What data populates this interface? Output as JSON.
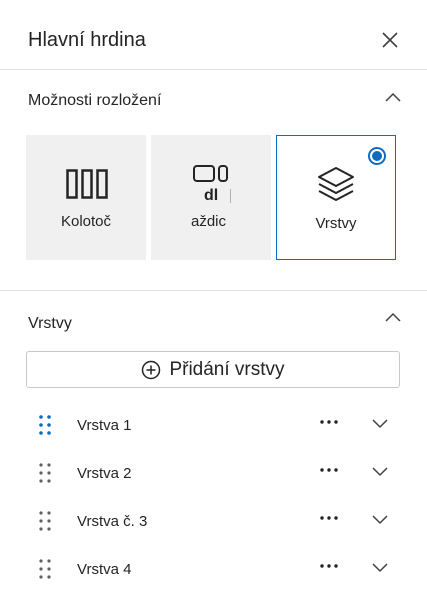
{
  "panel": {
    "title": "Hlavní hrdina"
  },
  "layout_section": {
    "title": "Možnosti rozložení",
    "options": [
      {
        "label": "Kolotoč",
        "icon": "carousel-icon",
        "selected": false
      },
      {
        "label": "aždic",
        "icon": "tiles-icon",
        "icon_text": "dl",
        "selected": false
      },
      {
        "label": "Vrstvy",
        "icon": "layers-icon",
        "selected": true
      }
    ]
  },
  "layers_section": {
    "title": "Vrstvy",
    "add_button_label": "Přidání vrstvy",
    "items": [
      {
        "name": "Vrstva 1",
        "handle_color": "#0f6cbd"
      },
      {
        "name": "Vrstva 2",
        "handle_color": "#616161"
      },
      {
        "name": "Vrstva č. 3",
        "handle_color": "#616161"
      },
      {
        "name": "Vrstva 4",
        "handle_color": "#616161"
      }
    ]
  },
  "colors": {
    "accent": "#0f6cbd",
    "tile_background": "#f0f0f0",
    "divider": "#e1e1e1"
  }
}
